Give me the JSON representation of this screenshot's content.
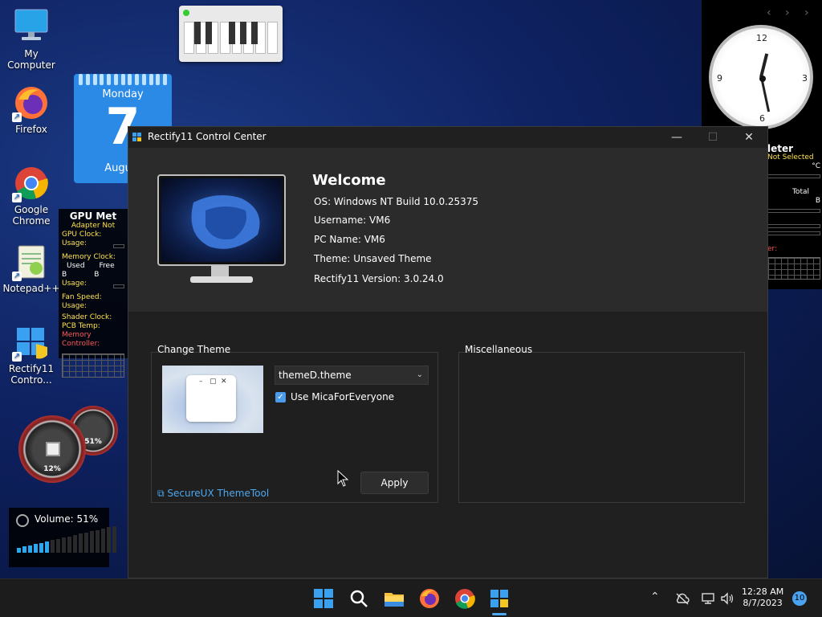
{
  "desktop": {
    "icons": [
      {
        "label": "My Computer"
      },
      {
        "label": "Firefox"
      },
      {
        "label": "Google Chrome"
      },
      {
        "label": "Notepad++"
      },
      {
        "label": "Rectify11 Contro..."
      }
    ],
    "calendar": {
      "day": "Monday",
      "date": "7",
      "month": "August"
    },
    "gpu_meter": {
      "title": "GPU Met",
      "adapter": "Adapter Not",
      "gpu_clock": "GPU Clock:",
      "usage1": "Usage:",
      "memory_clock": "Memory Clock:",
      "used": "Used",
      "free": "Free",
      "b1": "B",
      "b2": "B",
      "usage2": "Usage:",
      "fan_speed": "Fan Speed:",
      "usage3": "Usage:",
      "shader_clock": "Shader Clock:",
      "pcb_temp": "PCB Temp:",
      "memory_controller": "Memory Controller:"
    },
    "gauges": {
      "cpu": "12%",
      "mem": "51%"
    },
    "volume": {
      "label": "Volume: 51%",
      "level": 0.51
    },
    "clock": {
      "n12": "12",
      "n3": "3",
      "n6": "6",
      "n9": "9"
    },
    "meter2": {
      "title": "leter",
      "not_selected": "Not Selected",
      "unit": "°C",
      "total": "Total",
      "b": "B",
      "red": "er:"
    }
  },
  "window": {
    "title": "Rectify11 Control Center",
    "controls": {
      "minimize": "—",
      "maximize": "☐",
      "close": "✕"
    },
    "welcome": "Welcome",
    "os": "OS: Windows NT Build 10.0.25375",
    "username": "Username: VM6",
    "pcname": "PC Name: VM6",
    "theme": "Theme: Unsaved Theme",
    "version": "Rectify11 Version: 3.0.24.0",
    "change_theme": {
      "title": "Change Theme",
      "selected_theme": "themeD.theme",
      "mica_label": "Use MicaForEveryone",
      "mica_checked": true,
      "apply": "Apply",
      "link": "SecureUX ThemeTool"
    },
    "misc": {
      "title": "Miscellaneous"
    }
  },
  "taskbar": {
    "time": "12:28 AM",
    "date": "8/7/2023",
    "notifications": "10"
  },
  "colors": {
    "accent": "#4c9be8",
    "link": "#4ca8f0",
    "window_bg": "#202020"
  }
}
